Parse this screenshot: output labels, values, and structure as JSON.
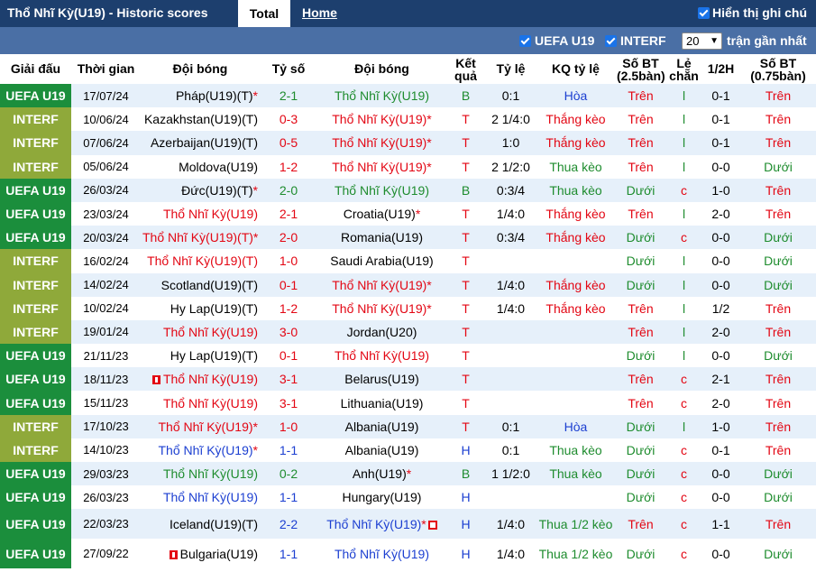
{
  "header": {
    "title": "Thổ Nhĩ Kỳ(U19) - Historic scores",
    "tab_total": "Total",
    "tab_home": "Home",
    "show_all_label": "Hiển thị ghi chú"
  },
  "filters": {
    "uefa_label": "UEFA U19",
    "interf_label": "INTERF",
    "count_value": "20",
    "recent_label": "trận gần nhất"
  },
  "columns": [
    "Giải đấu",
    "Thời gian",
    "Đội bóng",
    "Tỷ số",
    "Đội bóng",
    "Kết quả",
    "Tỷ lệ",
    "KQ tỷ lệ",
    "Số BT (2.5bàn)",
    "Lẻ chẵn",
    "1/2H",
    "Số BT (0.75bàn)"
  ],
  "colors": {
    "uefa": "#1b8e3c",
    "interf": "#8fa93a",
    "header_bg": "#1d3f6e",
    "filter_bg": "#4a6fa5"
  },
  "rows": [
    {
      "league": "UEFA U19",
      "date": "17/07/24",
      "home": "Pháp(U19)(T)",
      "home_star": "*",
      "score": "2-1",
      "away": "Thổ Nhĩ Kỳ(U19)",
      "away_star": "",
      "result": "B",
      "odds": "0:1",
      "odds_result": "Hòa",
      "bt25": "Trên",
      "oe": "l",
      "half": "0-1",
      "bt075": "Trên"
    },
    {
      "league": "INTERF",
      "date": "10/06/24",
      "home": "Kazakhstan(U19)(T)",
      "home_star": "",
      "score": "0-3",
      "away": "Thổ Nhĩ Kỳ(U19)",
      "away_star": "*",
      "result": "T",
      "odds": "2 1/4:0",
      "odds_result": "Thắng kèo",
      "bt25": "Trên",
      "oe": "l",
      "half": "0-1",
      "bt075": "Trên"
    },
    {
      "league": "INTERF",
      "date": "07/06/24",
      "home": "Azerbaijan(U19)(T)",
      "home_star": "",
      "score": "0-5",
      "away": "Thổ Nhĩ Kỳ(U19)",
      "away_star": "*",
      "result": "T",
      "odds": "1:0",
      "odds_result": "Thắng kèo",
      "bt25": "Trên",
      "oe": "l",
      "half": "0-1",
      "bt075": "Trên"
    },
    {
      "league": "INTERF",
      "date": "05/06/24",
      "home": "Moldova(U19)",
      "home_star": "",
      "score": "1-2",
      "away": "Thổ Nhĩ Kỳ(U19)",
      "away_star": "*",
      "result": "T",
      "odds": "2 1/2:0",
      "odds_result": "Thua kèo",
      "bt25": "Trên",
      "oe": "l",
      "half": "0-0",
      "bt075": "Dưới"
    },
    {
      "league": "UEFA U19",
      "date": "26/03/24",
      "home": "Đức(U19)(T)",
      "home_star": "*",
      "score": "2-0",
      "away": "Thổ Nhĩ Kỳ(U19)",
      "away_star": "",
      "result": "B",
      "odds": "0:3/4",
      "odds_result": "Thua kèo",
      "bt25": "Dưới",
      "oe": "c",
      "half": "1-0",
      "bt075": "Trên"
    },
    {
      "league": "UEFA U19",
      "date": "23/03/24",
      "home": "Thổ Nhĩ Kỳ(U19)",
      "home_star": "",
      "score": "2-1",
      "away": "Croatia(U19)",
      "away_star": "*",
      "result": "T",
      "odds": "1/4:0",
      "odds_result": "Thắng kèo",
      "bt25": "Trên",
      "oe": "l",
      "half": "2-0",
      "bt075": "Trên"
    },
    {
      "league": "UEFA U19",
      "date": "20/03/24",
      "home": "Thổ Nhĩ Kỳ(U19)(T)",
      "home_star": "*",
      "score": "2-0",
      "away": "Romania(U19)",
      "away_star": "",
      "result": "T",
      "odds": "0:3/4",
      "odds_result": "Thắng kèo",
      "bt25": "Dưới",
      "oe": "c",
      "half": "0-0",
      "bt075": "Dưới"
    },
    {
      "league": "INTERF",
      "date": "16/02/24",
      "home": "Thổ Nhĩ Kỳ(U19)(T)",
      "home_star": "",
      "score": "1-0",
      "away": "Saudi Arabia(U19)",
      "away_star": "",
      "result": "T",
      "odds": "",
      "odds_result": "",
      "bt25": "Dưới",
      "oe": "l",
      "half": "0-0",
      "bt075": "Dưới"
    },
    {
      "league": "INTERF",
      "date": "14/02/24",
      "home": "Scotland(U19)(T)",
      "home_star": "",
      "score": "0-1",
      "away": "Thổ Nhĩ Kỳ(U19)",
      "away_star": "*",
      "result": "T",
      "odds": "1/4:0",
      "odds_result": "Thắng kèo",
      "bt25": "Dưới",
      "oe": "l",
      "half": "0-0",
      "bt075": "Dưới"
    },
    {
      "league": "INTERF",
      "date": "10/02/24",
      "home": "Hy Lap(U19)(T)",
      "home_star": "",
      "score": "1-2",
      "away": "Thổ Nhĩ Kỳ(U19)",
      "away_star": "*",
      "result": "T",
      "odds": "1/4:0",
      "odds_result": "Thắng kèo",
      "bt25": "Trên",
      "oe": "l",
      "half": "1/2",
      "bt075": "Trên"
    },
    {
      "league": "INTERF",
      "date": "19/01/24",
      "home": "Thổ Nhĩ Kỳ(U19)",
      "home_star": "",
      "score": "3-0",
      "away": "Jordan(U20)",
      "away_star": "",
      "result": "T",
      "odds": "",
      "odds_result": "",
      "bt25": "Trên",
      "oe": "l",
      "half": "2-0",
      "bt075": "Trên"
    },
    {
      "league": "UEFA U19",
      "date": "21/11/23",
      "home": "Hy Lap(U19)(T)",
      "home_star": "",
      "score": "0-1",
      "away": "Thổ Nhĩ Kỳ(U19)",
      "away_star": "",
      "result": "T",
      "odds": "",
      "odds_result": "",
      "bt25": "Dưới",
      "oe": "l",
      "half": "0-0",
      "bt075": "Dưới"
    },
    {
      "league": "UEFA U19",
      "date": "18/11/23",
      "home": "Thổ Nhĩ Kỳ(U19)",
      "home_star": "",
      "home_flag": true,
      "score": "3-1",
      "away": "Belarus(U19)",
      "away_star": "",
      "result": "T",
      "odds": "",
      "odds_result": "",
      "bt25": "Trên",
      "oe": "c",
      "half": "2-1",
      "bt075": "Trên"
    },
    {
      "league": "UEFA U19",
      "date": "15/11/23",
      "home": "Thổ Nhĩ Kỳ(U19)",
      "home_star": "",
      "score": "3-1",
      "away": "Lithuania(U19)",
      "away_star": "",
      "result": "T",
      "odds": "",
      "odds_result": "",
      "bt25": "Trên",
      "oe": "c",
      "half": "2-0",
      "bt075": "Trên"
    },
    {
      "league": "INTERF",
      "date": "17/10/23",
      "home": "Thổ Nhĩ Kỳ(U19)",
      "home_star": "*",
      "score": "1-0",
      "away": "Albania(U19)",
      "away_star": "",
      "result": "T",
      "odds": "0:1",
      "odds_result": "Hòa",
      "bt25": "Dưới",
      "oe": "l",
      "half": "1-0",
      "bt075": "Trên"
    },
    {
      "league": "INTERF",
      "date": "14/10/23",
      "home": "Thổ Nhĩ Kỳ(U19)",
      "home_star": "*",
      "score": "1-1",
      "away": "Albania(U19)",
      "away_star": "",
      "result": "H",
      "odds": "0:1",
      "odds_result": "Thua kèo",
      "bt25": "Dưới",
      "oe": "c",
      "half": "0-1",
      "bt075": "Trên"
    },
    {
      "league": "UEFA U19",
      "date": "29/03/23",
      "home": "Thổ Nhĩ Kỳ(U19)",
      "home_star": "",
      "score": "0-2",
      "away": "Anh(U19)",
      "away_star": "*",
      "result": "B",
      "odds": "1 1/2:0",
      "odds_result": "Thua kèo",
      "bt25": "Dưới",
      "oe": "c",
      "half": "0-0",
      "bt075": "Dưới"
    },
    {
      "league": "UEFA U19",
      "date": "26/03/23",
      "home": "Thổ Nhĩ Kỳ(U19)",
      "home_star": "",
      "score": "1-1",
      "away": "Hungary(U19)",
      "away_star": "",
      "result": "H",
      "odds": "",
      "odds_result": "",
      "bt25": "Dưới",
      "oe": "c",
      "half": "0-0",
      "bt075": "Dưới"
    },
    {
      "league": "UEFA U19",
      "date": "22/03/23",
      "home": "Iceland(U19)(T)",
      "home_star": "",
      "score": "2-2",
      "away": "Thổ Nhĩ Kỳ(U19)",
      "away_star": "*",
      "away_flag": true,
      "result": "H",
      "odds": "1/4:0",
      "odds_result": "Thua 1/2 kèo",
      "bt25": "Trên",
      "oe": "c",
      "half": "1-1",
      "bt075": "Trên"
    },
    {
      "league": "UEFA U19",
      "date": "27/09/22",
      "home": "Bulgaria(U19)",
      "home_star": "",
      "home_flag": true,
      "score": "1-1",
      "away": "Thổ Nhĩ Kỳ(U19)",
      "away_star": "",
      "result": "H",
      "odds": "1/4:0",
      "odds_result": "Thua 1/2 kèo",
      "bt25": "Dưới",
      "oe": "c",
      "half": "0-0",
      "bt075": "Dưới"
    }
  ]
}
